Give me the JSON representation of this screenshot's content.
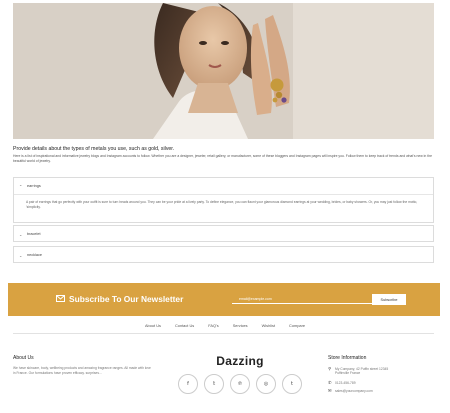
{
  "hero": {
    "image": "woman-with-gold-rings-photo"
  },
  "intro": {
    "heading": "Provide details about the types of metals you use, such as gold, silver.",
    "text": "Here is a list of inspirational and informative jewelry blogs and Instagram accounts to follow. Whether you are a designer, jeweler, retail gallery, or manufacturer, some of these bloggers and Instagram pages will inspire you. Follow them to keep track of trends and what's new in the beautiful world of jewelry."
  },
  "accordion": {
    "items": [
      {
        "label": "earrings",
        "expanded": true,
        "body": "A pair of earrings that go perfectly with your outfit is sure to turn heads around you. They can be your pride at a lively party. To define elegance, you can flaunt your glamorous diamond earrings at your wedding, brides, or baby showers. Or, you may just follow the motto, 'simplicity."
      },
      {
        "label": "bracelet",
        "expanded": false
      },
      {
        "label": "necklace",
        "expanded": false
      }
    ]
  },
  "newsletter": {
    "title": "Subscribe To Our Newsletter",
    "email_placeholder": "email@example.com",
    "button": "Subscribe",
    "background": "#d9a241"
  },
  "footer_nav": [
    "About Us",
    "Contact Us",
    "FAQ's",
    "Services",
    "Wishlist",
    "Compare"
  ],
  "about": {
    "title": "About Us",
    "text": "We have skincare, body, wellbeing products and amazing fragrance ranges. All made with love in France. Our formulations have proven efficacy. surprises..."
  },
  "brand": {
    "name": "Dazzing"
  },
  "socials": [
    "facebook-icon",
    "twitter-icon",
    "pinterest-icon",
    "instagram-icon",
    "tumblr-icon"
  ],
  "store": {
    "title": "Store Information",
    "address": "My Company, 42 Puffin street 12345 Puffinville France",
    "phone": "0123-456-789",
    "email": "sales@yourcompany.com"
  }
}
